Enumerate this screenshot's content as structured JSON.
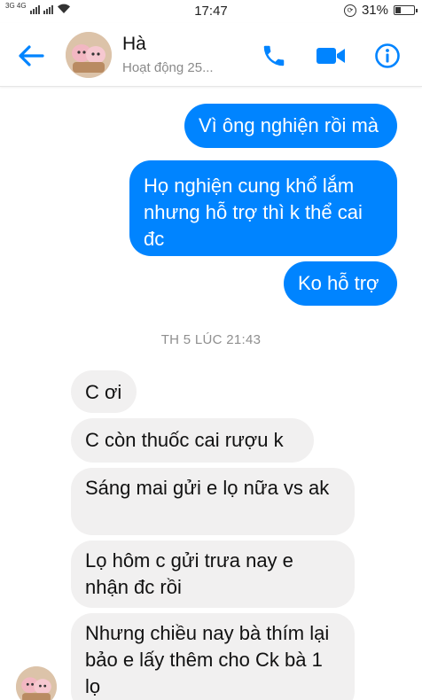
{
  "status_bar": {
    "network": "3G 4G",
    "time": "17:47",
    "battery": "31%",
    "battery_level": 0.31
  },
  "header": {
    "name": "Hà",
    "status": "Hoạt động 25...",
    "icons": [
      "back-arrow-icon",
      "phone-icon",
      "video-camera-icon",
      "info-icon"
    ],
    "accent_color": "#0084ff"
  },
  "messages": {
    "sent": [
      "Vì ông nghiện rồi mà",
      "Họ nghiện cung khổ lắm nhưng hỗ trợ thì k thể cai đc",
      "Ko hỗ trợ"
    ],
    "divider": "TH 5 LÚC 21:43",
    "received": [
      "C ơi",
      "C còn thuốc cai rượu k",
      "Sáng mai gửi e lọ nữa vs ak",
      "Lọ hôm c gửi trưa nay e nhận đc rồi",
      "Nhưng chiều nay bà thím lại bảo e lấy thêm cho Ck bà 1 lọ"
    ],
    "colors": {
      "sent_bg": "#0084ff",
      "received_bg": "#f1f0f0"
    }
  }
}
